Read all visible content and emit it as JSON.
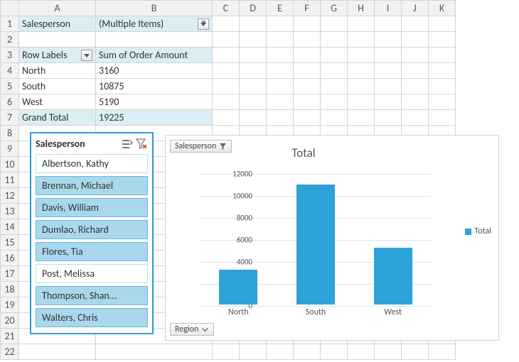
{
  "columns": [
    "A",
    "B",
    "C",
    "D",
    "E",
    "F",
    "G",
    "H",
    "I",
    "J",
    "K"
  ],
  "rows_count": 22,
  "pivot": {
    "page_field_label": "Salesperson",
    "page_field_value": "(Multiple Items)",
    "row_header": "Row Labels",
    "value_header": "Sum of Order Amount",
    "rows": [
      {
        "label": "North",
        "value": "3160"
      },
      {
        "label": "South",
        "value": "10875"
      },
      {
        "label": "West",
        "value": "5190"
      }
    ],
    "grand_label": "Grand Total",
    "grand_value": "19225"
  },
  "slicer": {
    "title": "Salesperson",
    "items": [
      {
        "label": "Albertson, Kathy",
        "selected": false
      },
      {
        "label": "Brennan, Michael",
        "selected": true
      },
      {
        "label": "Davis, William",
        "selected": true
      },
      {
        "label": "Dumlao, Richard",
        "selected": true
      },
      {
        "label": "Flores, Tia",
        "selected": true
      },
      {
        "label": "Post, Melissa",
        "selected": false
      },
      {
        "label": "Thompson, Shan...",
        "selected": true
      },
      {
        "label": "Walters, Chris",
        "selected": true
      }
    ]
  },
  "chart_data": {
    "type": "bar",
    "title": "Total",
    "categories": [
      "North",
      "South",
      "West"
    ],
    "series": [
      {
        "name": "Total",
        "values": [
          3160,
          10875,
          5190
        ]
      }
    ],
    "ylim": [
      0,
      12000
    ],
    "ytick_interval": 2000,
    "page_field_button": "Salesperson",
    "axis_field_button": "Region"
  }
}
